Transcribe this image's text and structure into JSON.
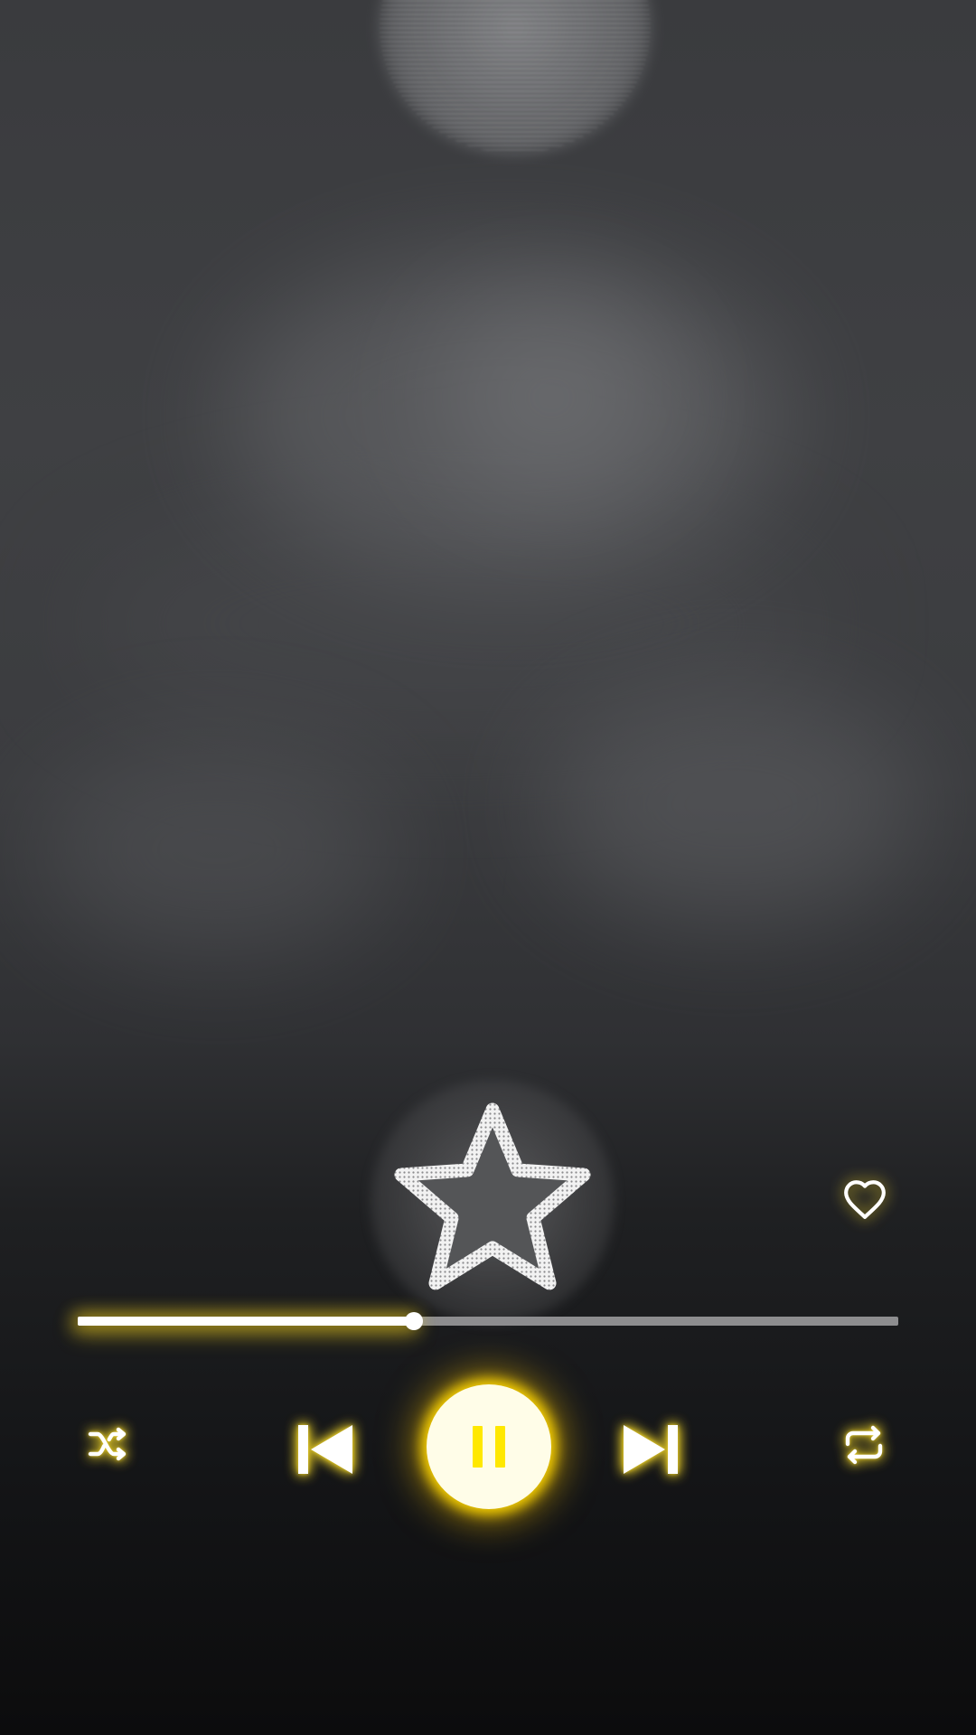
{
  "player": {
    "state": "playing",
    "progress_fraction": 0.41,
    "favorite": false
  },
  "icons": {
    "center": "star-outline-icon",
    "favorite": "heart-outline-icon",
    "shuffle": "shuffle-icon",
    "previous": "skip-previous-icon",
    "play_pause": "pause-icon",
    "next": "skip-next-icon",
    "repeat": "repeat-icon"
  },
  "colors": {
    "accent_glow": "#ffe100",
    "pause_bars": "#ffe800",
    "play_button": "#fffde8",
    "progress_fill": "#ffffff",
    "progress_track": "#8d8d8f"
  }
}
